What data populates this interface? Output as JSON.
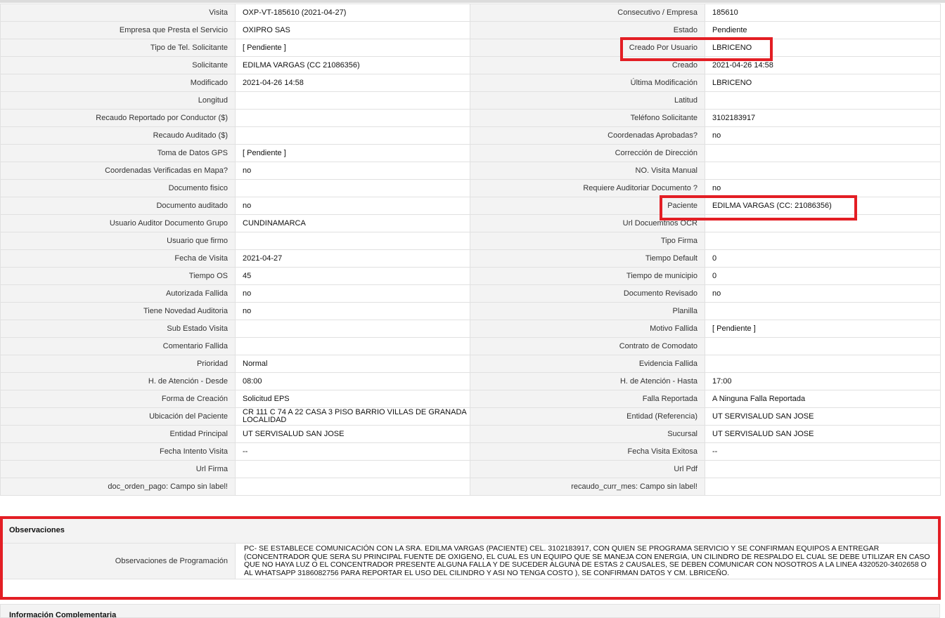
{
  "fields": [
    {
      "left_label": "Visita",
      "left_value": "OXP-VT-185610 (2021-04-27)",
      "right_label": "Consecutivo / Empresa",
      "right_value": "185610"
    },
    {
      "left_label": "Empresa que Presta el Servicio",
      "left_value": "OXIPRO SAS",
      "right_label": "Estado",
      "right_value": "Pendiente"
    },
    {
      "left_label": "Tipo de Tel. Solicitante",
      "left_value": "[ Pendiente ]",
      "right_label": "Creado Por Usuario",
      "right_value": "LBRICENO"
    },
    {
      "left_label": "Solicitante",
      "left_value": "EDILMA VARGAS (CC 21086356)",
      "right_label": "Creado",
      "right_value": "2021-04-26 14:58"
    },
    {
      "left_label": "Modificado",
      "left_value": "2021-04-26 14:58",
      "right_label": "Última Modificación",
      "right_value": " LBRICENO"
    },
    {
      "left_label": "Longitud",
      "left_value": "",
      "right_label": "Latitud",
      "right_value": ""
    },
    {
      "left_label": "Recaudo Reportado por Conductor ($)",
      "left_value": "",
      "right_label": "Teléfono Solicitante",
      "right_value": "3102183917"
    },
    {
      "left_label": "Recaudo Auditado ($)",
      "left_value": "",
      "right_label": "Coordenadas Aprobadas?",
      "right_value": " no"
    },
    {
      "left_label": "Toma de Datos GPS",
      "left_value": "[ Pendiente ]",
      "right_label": "Corrección de Dirección",
      "right_value": ""
    },
    {
      "left_label": "Coordenadas Verificadas en Mapa?",
      "left_value": " no",
      "right_label": "NO. Visita Manual",
      "right_value": ""
    },
    {
      "left_label": "Documento fisico",
      "left_value": "",
      "right_label": "Requiere Auditoriar Documento ?",
      "right_value": " no"
    },
    {
      "left_label": "Documento auditado",
      "left_value": " no",
      "right_label": "Paciente",
      "right_value": "EDILMA VARGAS (CC: 21086356)"
    },
    {
      "left_label": "Usuario Auditor Documento Grupo",
      "left_value": "CUNDINAMARCA",
      "right_label": "Url Docuemtnos OCR",
      "right_value": ""
    },
    {
      "left_label": "Usuario que firmo",
      "left_value": "",
      "right_label": "Tipo Firma",
      "right_value": ""
    },
    {
      "left_label": "Fecha de Visita",
      "left_value": " 2021-04-27",
      "right_label": "Tiempo Default",
      "right_value": "0"
    },
    {
      "left_label": "Tiempo OS",
      "left_value": "45",
      "right_label": "Tiempo de municipio",
      "right_value": "0"
    },
    {
      "left_label": "Autorizada Fallida",
      "left_value": " no",
      "right_label": "Documento Revisado",
      "right_value": " no"
    },
    {
      "left_label": "Tiene Novedad Auditoria",
      "left_value": " no",
      "right_label": "Planilla",
      "right_value": ""
    },
    {
      "left_label": "Sub Estado Visita",
      "left_value": "",
      "right_label": "Motivo Fallida",
      "right_value": "[ Pendiente ]"
    },
    {
      "left_label": "Comentario Fallida",
      "left_value": "",
      "right_label": "Contrato de Comodato",
      "right_value": ""
    },
    {
      "left_label": "Prioridad",
      "left_value": "Normal",
      "right_label": "Evidencia Fallida",
      "right_value": ""
    },
    {
      "left_label": "H. de Atención - Desde",
      "left_value": "08:00",
      "right_label": "H. de Atención - Hasta",
      "right_value": "17:00"
    },
    {
      "left_label": "Forma de Creación",
      "left_value": "Solicitud EPS",
      "right_label": "Falla Reportada",
      "right_value": "A Ninguna Falla Reportada"
    },
    {
      "left_label": "Ubicación del Paciente",
      "left_value": "CR 111 C 74 A 22 CASA 3 PISO BARRIO VILLAS DE GRANADA LOCALIDAD",
      "right_label": "Entidad (Referencia)",
      "right_value": "UT SERVISALUD SAN JOSE"
    },
    {
      "left_label": "Entidad Principal",
      "left_value": "UT SERVISALUD SAN JOSE",
      "right_label": "Sucursal",
      "right_value": "UT SERVISALUD SAN JOSE"
    },
    {
      "left_label": "Fecha Intento Visita",
      "left_value": " --",
      "right_label": "Fecha Visita Exitosa",
      "right_value": " --"
    },
    {
      "left_label": "Url Firma",
      "left_value": "",
      "right_label": "Url Pdf",
      "right_value": ""
    },
    {
      "left_label": "doc_orden_pago: Campo sin label!",
      "left_value": "",
      "right_label": "recaudo_curr_mes: Campo sin label!",
      "right_value": ""
    }
  ],
  "observaciones": {
    "title": "Observaciones",
    "label": "Observaciones de Programación",
    "text": "  PC- SE ESTABLECE COMUNICACIÓN CON LA SRA. EDILMA VARGAS (PACIENTE) CEL. 3102183917, CON QUIEN SE PROGRAMA SERVICIO Y SE CONFIRMAN EQUIPOS A ENTREGAR (CONCENTRADOR QUE SERA SU PRINCIPAL FUENTE DE OXIGENO, EL CUAL ES UN EQUIPO QUE SE MANEJA CON ENERGIA, UN CILINDRO DE RESPALDO EL CUAL SE DEBE UTILIZAR EN CASO QUE NO HAYA LUZ O EL CONCENTRADOR PRESENTE ALGUNA FALLA Y DE SUCEDER ALGUNA DE ESTAS 2 CAUSALES, SE DEBEN COMUNICAR CON NOSOTROS A LA LINEA 4320520-3402658 O AL WHATSAPP 3186082756 PARA REPORTAR EL USO DEL CILINDRO Y ASI NO TENGA COSTO ), SE CONFIRMAN DATOS Y CM. LBRICEÑO."
  },
  "info_complementaria": {
    "title": "Información Complementaria"
  },
  "colors": {
    "highlight": "#e31e24",
    "label_bg": "#f3f3f3",
    "border": "#e1e1e1"
  }
}
